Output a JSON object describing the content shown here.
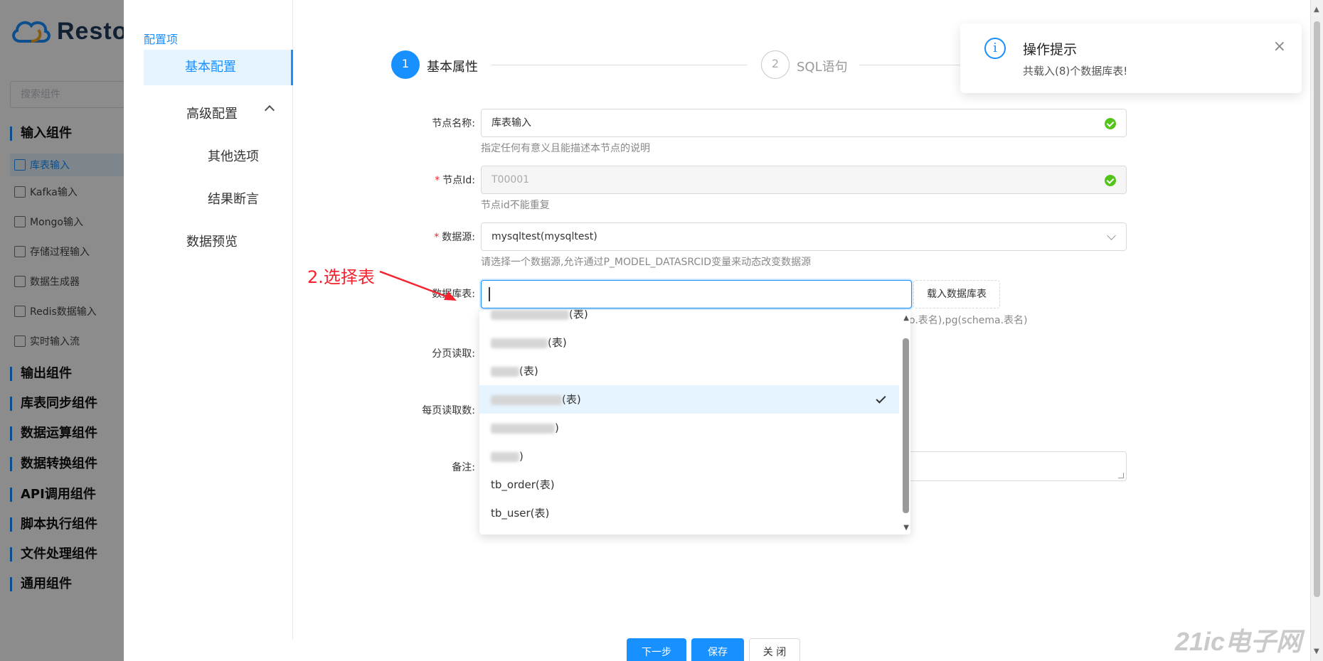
{
  "app": {
    "logo_text": "Resto",
    "search_placeholder": "搜索组件",
    "categories": [
      {
        "label": "输入组件",
        "items": [
          {
            "label": "库表输入",
            "icon": "table-input-icon",
            "active": true
          },
          {
            "label": "Kafka输入",
            "icon": "kafka-icon"
          },
          {
            "label": "Mongo输入",
            "icon": "mongo-icon"
          },
          {
            "label": "存储过程输入",
            "icon": "procedure-icon"
          },
          {
            "label": "数据生成器",
            "icon": "generator-icon"
          },
          {
            "label": "Redis数据输入",
            "icon": "redis-icon"
          },
          {
            "label": "实时输入流",
            "icon": "stream-icon"
          }
        ]
      },
      {
        "label": "输出组件"
      },
      {
        "label": "库表同步组件"
      },
      {
        "label": "数据运算组件"
      },
      {
        "label": "数据转换组件"
      },
      {
        "label": "API调用组件"
      },
      {
        "label": "脚本执行组件"
      },
      {
        "label": "文件处理组件"
      },
      {
        "label": "通用组件"
      }
    ]
  },
  "drawer": {
    "side_title": "配置项",
    "menu": {
      "basic": "基本配置",
      "advanced": "高级配置",
      "other": "其他选项",
      "assert": "结果断言",
      "preview": "数据预览"
    },
    "steps": [
      {
        "num": "1",
        "label": "基本属性",
        "active": true
      },
      {
        "num": "2",
        "label": "SQL语句",
        "active": false
      }
    ],
    "form": {
      "node_name_label": "节点名称:",
      "node_name_value": "库表输入",
      "node_name_help": "指定任何有意义且能描述本节点的说明",
      "node_id_label": "节点Id:",
      "node_id_value": "T00001",
      "node_id_help": "节点id不能重复",
      "datasource_label": "数据源:",
      "datasource_value": "mysqltest(mysqltest)",
      "datasource_help": "请选择一个数据源,允许通过P_MODEL_DATASRCID变量来动态改变数据源",
      "table_label": "数据库表:",
      "table_value": "",
      "load_tables_button": "载入数据库表",
      "table_help_partial": "o.表名),pg(schema.表名)",
      "paging_label": "分页读取:",
      "page_size_label": "每页读取数:",
      "remark_label": "备注:"
    },
    "dropdown_options": [
      {
        "label": "(表)",
        "selected": false
      },
      {
        "label": "(表)",
        "selected": false
      },
      {
        "label": "(表)",
        "selected": false
      },
      {
        "label": "(表)",
        "selected": true
      },
      {
        "label": ")",
        "selected": false
      },
      {
        "label": ")",
        "selected": false
      },
      {
        "label": "tb_order(表)",
        "selected": false
      },
      {
        "label": "tb_user(表)",
        "selected": false
      }
    ],
    "footer": {
      "next": "下一步",
      "save": "保存",
      "close": "关 闭"
    }
  },
  "annotation": "2.选择表",
  "notification": {
    "title": "操作提示",
    "message": "共载入(8)个数据库表!",
    "close": "×"
  },
  "watermark": "21ic电子网",
  "colors": {
    "primary": "#1890ff",
    "success": "#52c41a",
    "required": "#f5222d",
    "annotation": "#f5222d"
  }
}
